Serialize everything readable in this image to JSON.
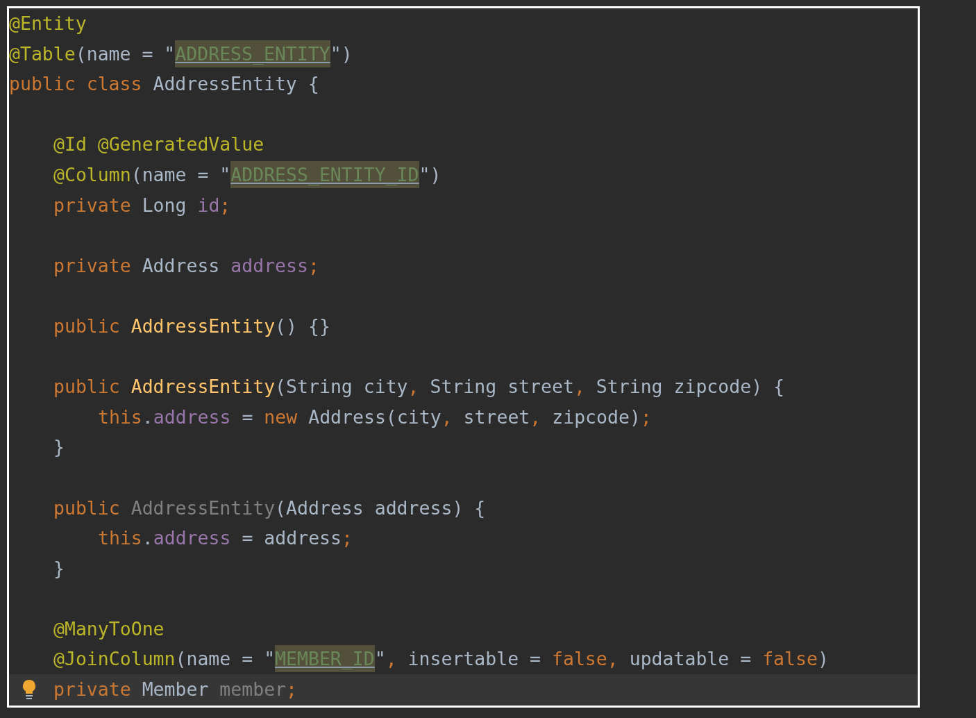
{
  "lines": [
    {
      "kind": "code",
      "bulb": false,
      "tokens": [
        {
          "text": "@Entity",
          "kind": "annotation"
        }
      ]
    },
    {
      "kind": "code",
      "bulb": false,
      "tokens": [
        {
          "text": "@Table",
          "kind": "annotation"
        },
        {
          "text": "(name = \"",
          "kind": "plain"
        },
        {
          "text": "ADDRESS_ENTITY",
          "kind": "ref-string"
        },
        {
          "text": "\")",
          "kind": "plain"
        }
      ]
    },
    {
      "kind": "code",
      "bulb": false,
      "tokens": [
        {
          "text": "public class ",
          "kind": "keyword"
        },
        {
          "text": "AddressEntity {",
          "kind": "plain"
        }
      ],
      "children": [
        {
          "kind": "blank"
        },
        {
          "kind": "code",
          "bulb": false,
          "tokens": [
            {
              "text": "@Id @GeneratedValue",
              "kind": "annotation"
            }
          ]
        },
        {
          "kind": "code",
          "bulb": false,
          "tokens": [
            {
              "text": "@Column",
              "kind": "annotation"
            },
            {
              "text": "(name = \"",
              "kind": "plain"
            },
            {
              "text": "ADDRESS_ENTITY_ID",
              "kind": "ref-string"
            },
            {
              "text": "\")",
              "kind": "plain"
            }
          ]
        },
        {
          "kind": "code",
          "bulb": false,
          "tokens": [
            {
              "text": "private ",
              "kind": "keyword"
            },
            {
              "text": "Long ",
              "kind": "plain"
            },
            {
              "text": "id",
              "kind": "field"
            },
            {
              "text": ";",
              "kind": "keyword"
            }
          ]
        },
        {
          "kind": "blank"
        },
        {
          "kind": "code",
          "bulb": false,
          "tokens": [
            {
              "text": "private ",
              "kind": "keyword"
            },
            {
              "text": "Address ",
              "kind": "plain"
            },
            {
              "text": "address",
              "kind": "field"
            },
            {
              "text": ";",
              "kind": "keyword"
            }
          ]
        },
        {
          "kind": "blank"
        },
        {
          "kind": "code",
          "bulb": false,
          "tokens": [
            {
              "text": "public ",
              "kind": "keyword"
            },
            {
              "text": "AddressEntity",
              "kind": "method"
            },
            {
              "text": "() {}",
              "kind": "plain"
            }
          ]
        },
        {
          "kind": "blank"
        },
        {
          "kind": "code",
          "bulb": false,
          "tokens": [
            {
              "text": "public ",
              "kind": "keyword"
            },
            {
              "text": "AddressEntity",
              "kind": "method"
            },
            {
              "text": "(String city",
              "kind": "plain"
            },
            {
              "text": ", ",
              "kind": "keyword"
            },
            {
              "text": "String street",
              "kind": "plain"
            },
            {
              "text": ", ",
              "kind": "keyword"
            },
            {
              "text": "String zipcode) {",
              "kind": "plain"
            }
          ],
          "children": [
            {
              "kind": "code",
              "bulb": false,
              "tokens": [
                {
                  "text": "this",
                  "kind": "keyword"
                },
                {
                  "text": ".",
                  "kind": "plain"
                },
                {
                  "text": "address ",
                  "kind": "field"
                },
                {
                  "text": "= ",
                  "kind": "plain"
                },
                {
                  "text": "new ",
                  "kind": "keyword"
                },
                {
                  "text": "Address(city",
                  "kind": "plain"
                },
                {
                  "text": ", ",
                  "kind": "keyword"
                },
                {
                  "text": "street",
                  "kind": "plain"
                },
                {
                  "text": ", ",
                  "kind": "keyword"
                },
                {
                  "text": "zipcode)",
                  "kind": "plain"
                },
                {
                  "text": ";",
                  "kind": "keyword"
                }
              ]
            }
          ],
          "closing": "}"
        },
        {
          "kind": "blank"
        },
        {
          "kind": "code",
          "bulb": false,
          "tokens": [
            {
              "text": "public ",
              "kind": "keyword"
            },
            {
              "text": "AddressEntity",
              "kind": "unused"
            },
            {
              "text": "(Address address) {",
              "kind": "plain"
            }
          ],
          "children": [
            {
              "kind": "code",
              "bulb": false,
              "tokens": [
                {
                  "text": "this",
                  "kind": "keyword"
                },
                {
                  "text": ".",
                  "kind": "plain"
                },
                {
                  "text": "address ",
                  "kind": "field"
                },
                {
                  "text": "= address",
                  "kind": "plain"
                },
                {
                  "text": ";",
                  "kind": "keyword"
                }
              ]
            }
          ],
          "closing": "}"
        },
        {
          "kind": "blank"
        },
        {
          "kind": "code",
          "bulb": false,
          "tokens": [
            {
              "text": "@ManyToOne",
              "kind": "annotation"
            }
          ]
        },
        {
          "kind": "code",
          "bulb": false,
          "tokens": [
            {
              "text": "@JoinColumn",
              "kind": "annotation"
            },
            {
              "text": "(name = \"",
              "kind": "plain"
            },
            {
              "text": "MEMBER_ID",
              "kind": "ref-string"
            },
            {
              "text": "\"",
              "kind": "plain"
            },
            {
              "text": ", ",
              "kind": "keyword"
            },
            {
              "text": "insertable = ",
              "kind": "plain"
            },
            {
              "text": "false, ",
              "kind": "keyword"
            },
            {
              "text": "updatable = ",
              "kind": "plain"
            },
            {
              "text": "false",
              "kind": "keyword"
            },
            {
              "text": ")",
              "kind": "plain"
            }
          ]
        },
        {
          "kind": "code",
          "bulb": true,
          "tokens": [
            {
              "text": "private ",
              "kind": "keyword"
            },
            {
              "text": "Member ",
              "kind": "plain"
            },
            {
              "text": "member",
              "kind": "unused"
            },
            {
              "text": ";",
              "kind": "keyword"
            }
          ]
        }
      ]
    }
  ]
}
